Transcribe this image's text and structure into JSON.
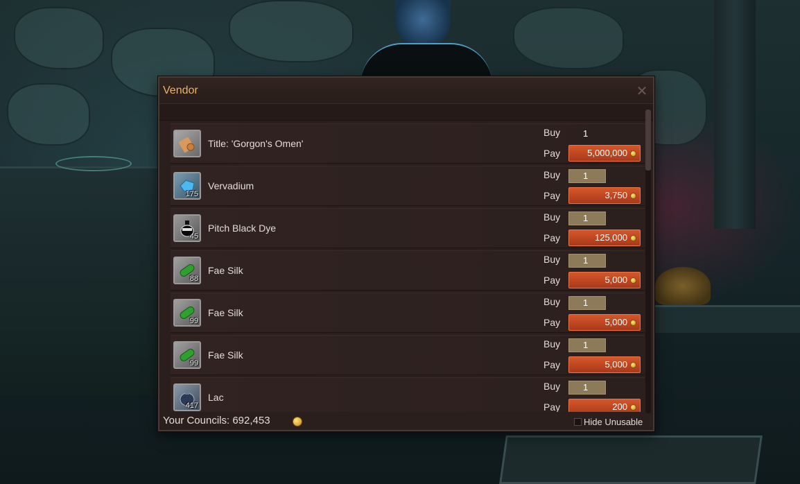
{
  "colors": {
    "title": "#e8b46c",
    "price_bg": "#c74a22",
    "qty_bg": "#8d7a58",
    "panel_bg": "#2a1f1d"
  },
  "vendor": {
    "title": "Vendor",
    "close_icon": "close-icon",
    "buy_label": "Buy",
    "pay_label": "Pay",
    "items": [
      {
        "name": "Title: 'Gorgon's Omen'",
        "count": "",
        "qty": "1",
        "price": "5,000,000",
        "icon": "scroll-icon"
      },
      {
        "name": "Vervadium",
        "count": "175",
        "qty": "1",
        "price": "3,750",
        "icon": "crystal-icon"
      },
      {
        "name": "Pitch Black Dye",
        "count": "45",
        "qty": "1",
        "price": "125,000",
        "icon": "dye-bottle-icon"
      },
      {
        "name": "Fae Silk",
        "count": "88",
        "qty": "1",
        "price": "5,000",
        "icon": "silk-roll-icon"
      },
      {
        "name": "Fae Silk",
        "count": "99",
        "qty": "1",
        "price": "5,000",
        "icon": "silk-roll-icon"
      },
      {
        "name": "Fae Silk",
        "count": "99",
        "qty": "1",
        "price": "5,000",
        "icon": "silk-roll-icon"
      },
      {
        "name": "Lac",
        "count": "417",
        "qty": "1",
        "price": "200",
        "icon": "lac-pouch-icon"
      }
    ],
    "footer": {
      "councils_label": "Your Councils: 692,453",
      "hide_unusable_label": "Hide Unusable"
    }
  }
}
